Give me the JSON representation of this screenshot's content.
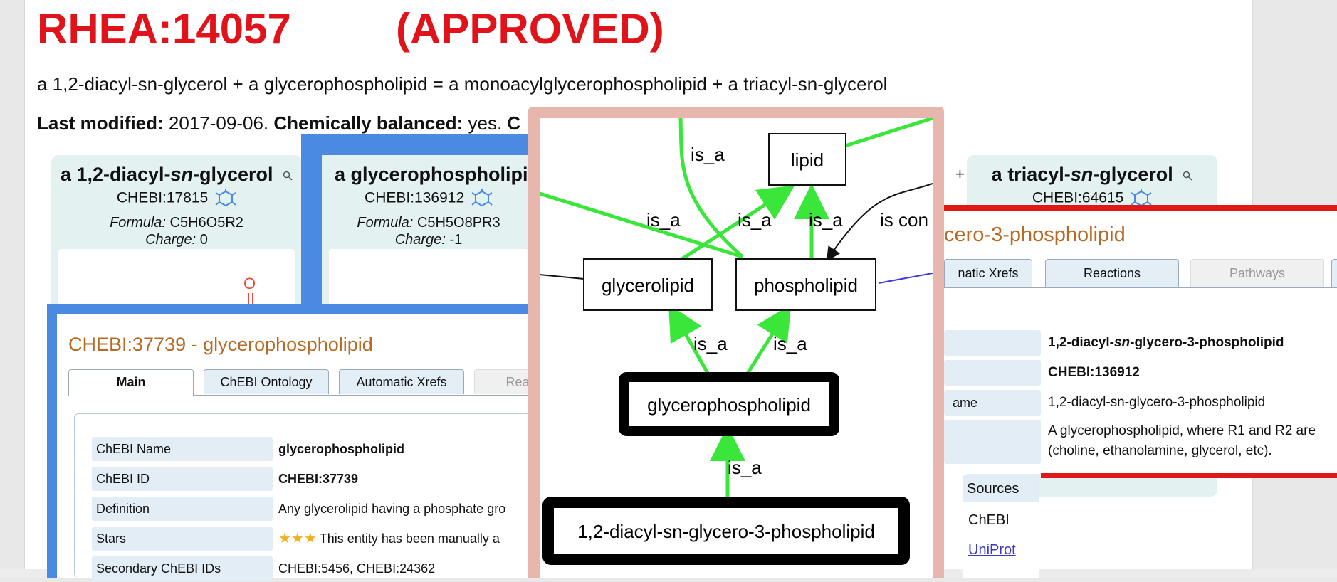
{
  "reaction": {
    "id": "RHEA:14057",
    "status": "(APPROVED)",
    "equation": "a 1,2-diacyl-sn-glycerol + a glycerophospholipid = a monoacylglycerophospholipid + a triacyl-sn-glycerol",
    "last_modified_label": "Last modified:",
    "last_modified": "2017-09-06.",
    "balanced_label": "Chemically balanced:",
    "balanced": "yes.",
    "trailing": "C"
  },
  "participants": [
    {
      "name_pre": "a 1,2-diacyl-",
      "name_it": "sn",
      "name_post": "-glycerol",
      "chebi": "CHEBI:17815",
      "formula_label": "Formula:",
      "formula": "C5H6O5R2",
      "charge_label": "Charge:",
      "charge": "0"
    },
    {
      "name": "a glycerophospholipid",
      "chebi": "CHEBI:136912",
      "formula_label": "Formula:",
      "formula": "C5H5O8PR3",
      "charge_label": "Charge:",
      "charge": "-1"
    },
    {
      "name_pre": "a triacyl-",
      "name_it": "sn",
      "name_post": "-glycerol",
      "chebi": "CHEBI:64615"
    }
  ],
  "plus_sign": "+",
  "structure_atom": "O",
  "chebi_popup": {
    "title": "CHEBI:37739 - glycerophospholipid",
    "tabs": [
      "Main",
      "ChEBI Ontology",
      "Automatic Xrefs",
      "Rea"
    ],
    "rows": [
      {
        "key": "ChEBI Name",
        "value": "glycerophospholipid"
      },
      {
        "key": "ChEBI ID",
        "value": "CHEBI:37739"
      },
      {
        "key": "Definition",
        "value": "Any glycerolipid having a phosphate gro"
      },
      {
        "key": "Stars",
        "stars": "★★★",
        "value": "This entity has been manually a"
      },
      {
        "key": "Secondary ChEBI IDs",
        "value": "CHEBI:5456, CHEBI:24362"
      }
    ]
  },
  "ontology_graph": {
    "nodes": [
      "lipid",
      "glycerolipid",
      "phospholipid",
      "glycerophospholipid",
      "1,2-diacyl-sn-glycero-3-phospholipid"
    ],
    "edge_labels": [
      "is_a",
      "is_a",
      "is_a",
      "is_a",
      "is con",
      "is_a",
      "is_a",
      "is_a"
    ]
  },
  "right_popup": {
    "title": "cero-3-phospholipid",
    "tabs": [
      "natic Xrefs",
      "Reactions",
      "Pathways"
    ],
    "rows": [
      {
        "key": "",
        "value": "1,2-diacyl-",
        "value_it": "sn",
        "value_post": "-glycero-3-phospholipid"
      },
      {
        "key": "",
        "value": "CHEBI:136912"
      },
      {
        "key": "ame",
        "value": "1,2-diacyl-sn-glycero-3-phospholipid"
      },
      {
        "key": "",
        "value": "A glycerophospholipid, where R1 and R2 are",
        "value2": "(choline, ethanolamine, glycerol, etc)."
      }
    ]
  },
  "sources": {
    "header": "Sources",
    "items": [
      "ChEBI",
      "UniProt"
    ]
  },
  "colors": {
    "title_red": "#e0131b",
    "panel_blue": "#4a8ae3",
    "graph_frame": "#e7b6ad",
    "edge_green": "#39e639",
    "popup_title": "#b76a24"
  }
}
